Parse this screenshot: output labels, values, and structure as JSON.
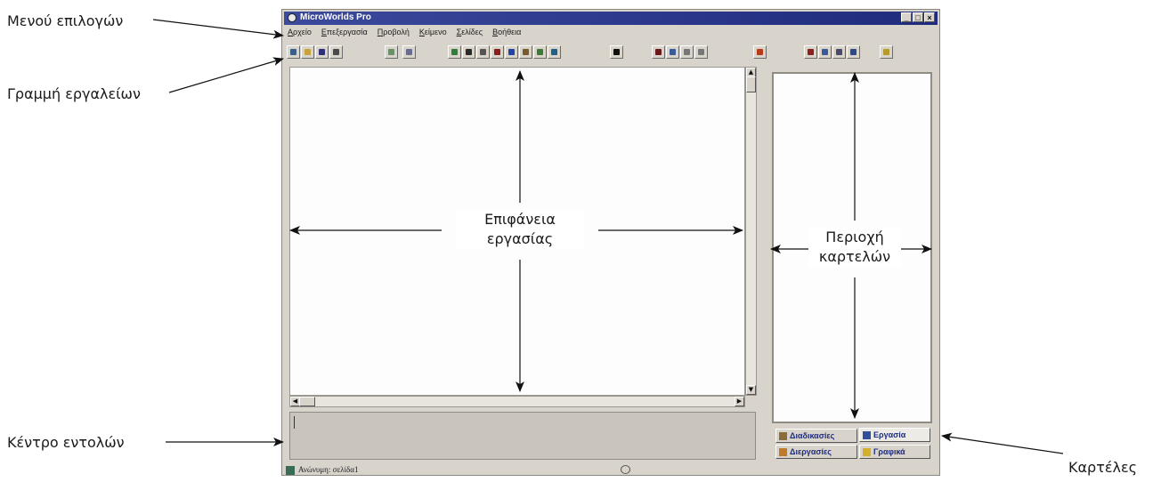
{
  "callouts": {
    "menu": "Μενού επιλογών",
    "toolbar": "Γραμμή εργαλείων",
    "command_center": "Κέντρο εντολών",
    "tabs": "Καρτέλες"
  },
  "window": {
    "title": "MicroWorlds Pro",
    "caption_buttons": [
      "_",
      "□",
      "×"
    ]
  },
  "menubar": [
    "Αρχείο",
    "Επεξεργασία",
    "Προβολή",
    "Κείμενο",
    "Σελίδες",
    "Βοήθεια"
  ],
  "toolbar_icons": [
    "new-page-icon",
    "open-icon",
    "save-icon",
    "print-icon",
    "page-view-icon",
    "full-view-icon",
    "turtle-icon",
    "text-box-icon",
    "button-tool-icon",
    "eye-icon",
    "music-icon",
    "brush-icon",
    "sprite-icon",
    "globe-icon",
    "pointer-icon",
    "show-icon",
    "stamp-icon",
    "zoom-in-icon",
    "zoom-out-icon",
    "stop-icon",
    "cut-icon",
    "copy-icon",
    "paste-icon",
    "undo-icon",
    "help-icon"
  ],
  "work_area_label": {
    "line1": "Επιφάνεια",
    "line2": "εργασίας"
  },
  "tab_area_label": {
    "line1": "Περιοχή",
    "line2": "καρτελών"
  },
  "tabs": [
    "Διαδικασίες",
    "Εργασία",
    "Διεργασίες",
    "Γραφικά"
  ],
  "status_bar": {
    "text": "Ανώνυμη: σελίδα1"
  },
  "colors": {
    "titlebar": "#2a378a",
    "window_bg": "#d8d4cc",
    "tab_text": "#1f2c7d"
  }
}
